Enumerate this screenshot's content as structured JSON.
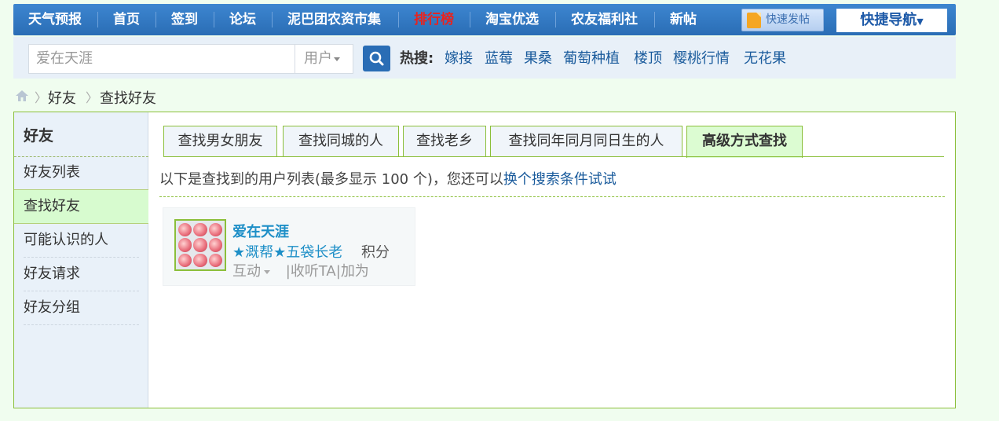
{
  "topnav": {
    "items": [
      {
        "label": "天气预报"
      },
      {
        "label": "首页"
      },
      {
        "label": "签到"
      },
      {
        "label": "论坛"
      },
      {
        "label": "泥巴团农资市集"
      },
      {
        "label": "排行榜",
        "highlight": true
      },
      {
        "label": "淘宝优选"
      },
      {
        "label": "农友福利社"
      },
      {
        "label": "新帖"
      }
    ],
    "quick_post": "快速发帖",
    "quick_nav": "快捷导航",
    "colors": {
      "bar": "#2a6db5",
      "hot": "#e8231e"
    }
  },
  "search": {
    "value": "爱在天涯",
    "type": "用户",
    "button_icon": "search-icon",
    "hot_label": "热搜:",
    "hot_terms": [
      "嫁接",
      "蓝莓",
      "果桑",
      "葡萄种植",
      "楼顶",
      "樱桃行情",
      "无花果"
    ]
  },
  "breadcrumb": {
    "home_icon": "home-icon",
    "items": [
      "好友",
      "查找好友"
    ]
  },
  "sidebar": {
    "title": "好友",
    "items": [
      {
        "label": "好友列表"
      },
      {
        "label": "查找好友",
        "active": true
      },
      {
        "label": "可能认识的人"
      },
      {
        "label": "好友请求"
      },
      {
        "label": "好友分组"
      }
    ]
  },
  "tabs": [
    {
      "label": "查找男女朋友"
    },
    {
      "label": "查找同城的人"
    },
    {
      "label": "查找老乡"
    },
    {
      "label": "查找同年同月同日生的人"
    },
    {
      "label": "高级方式查找",
      "active": true
    }
  ],
  "result": {
    "text": "以下是查找到的用户列表(最多显示 100 个)，您还可以",
    "link": "换个搜索条件试试"
  },
  "user_card": {
    "name": "爱在天涯",
    "rank": "★溉帮★五袋长老",
    "score_label": "积分",
    "interact": "互动",
    "follow": "收听TA",
    "add": "加为"
  }
}
